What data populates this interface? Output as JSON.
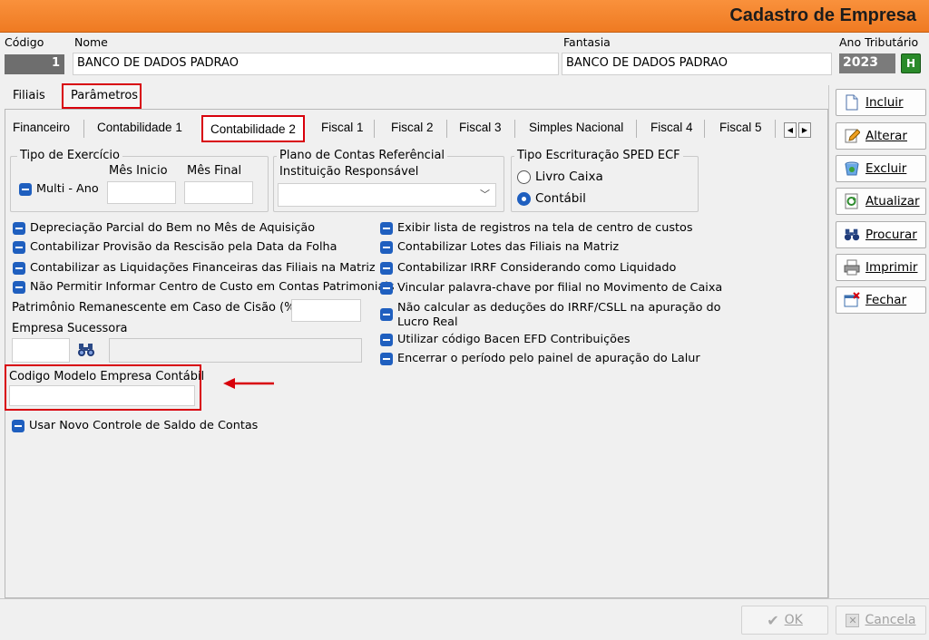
{
  "window": {
    "title": "Cadastro de Empresa"
  },
  "header": {
    "codigo_label": "Código",
    "codigo_value": "1",
    "nome_label": "Nome",
    "nome_value": "BANCO DE DADOS PADRAO",
    "fantasia_label": "Fantasia",
    "fantasia_value": "BANCO DE DADOS PADRAO",
    "ano_label": "Ano Tributário",
    "ano_value": "2023",
    "help_label": "H"
  },
  "main_tabs": [
    {
      "label": "Filiais"
    },
    {
      "label": "Parâmetros",
      "active": true
    }
  ],
  "sub_tabs": [
    {
      "label": "Financeiro"
    },
    {
      "label": "Contabilidade 1"
    },
    {
      "label": "Contabilidade 2",
      "active": true
    },
    {
      "label": "Fiscal 1"
    },
    {
      "label": "Fiscal 2"
    },
    {
      "label": "Fiscal 3"
    },
    {
      "label": "Simples Nacional"
    },
    {
      "label": "Fiscal 4"
    },
    {
      "label": "Fiscal 5"
    }
  ],
  "tipo_exercicio": {
    "title": "Tipo de Exercício",
    "multi_ano": "Multi - Ano",
    "mes_inicio": "Mês Inicio",
    "mes_final": "Mês Final"
  },
  "plano_contas": {
    "title": "Plano de Contas Referêncial",
    "instituicao": "Instituição Responsável"
  },
  "sped": {
    "title": "Tipo Escrituração SPED ECF",
    "options": [
      {
        "label": "Livro Caixa",
        "selected": false
      },
      {
        "label": "Contábil",
        "selected": true
      }
    ]
  },
  "checks_left": [
    "Depreciação Parcial do Bem no Mês de Aquisição",
    "Contabilizar Provisão da Rescisão pela Data da Folha",
    "Contabilizar as Liquidações Financeiras das Filiais na Matriz",
    "Não Permitir Informar Centro de Custo em Contas Patrimoniais"
  ],
  "checks_right": [
    "Exibir lista de registros na tela de centro de custos",
    "Contabilizar Lotes das Filiais na Matriz",
    "Contabilizar IRRF Considerando como Liquidado",
    "Vincular palavra-chave por filial no Movimento de Caixa",
    "Não calcular as deduções do IRRF/CSLL na apuração do Lucro Real",
    "Utilizar código Bacen EFD Contribuições",
    "Encerrar o período pelo painel de apuração do Lalur"
  ],
  "patrimonio_label": "Patrimônio Remanescente em Caso de Cisão (%):",
  "empresa_sucessora_label": "Empresa Sucessora",
  "codigo_modelo_label": "Codigo Modelo Empresa Contábil",
  "usar_novo_label": "Usar Novo Controle de Saldo de Contas",
  "side_buttons": [
    {
      "label": "Incluir",
      "icon": "new-document-icon"
    },
    {
      "label": "Alterar",
      "icon": "edit-pencil-icon"
    },
    {
      "label": "Excluir",
      "icon": "recycle-bin-icon"
    },
    {
      "label": "Atualizar",
      "icon": "refresh-icon"
    },
    {
      "label": "Procurar",
      "icon": "binoculars-icon"
    },
    {
      "label": "Imprimir",
      "icon": "printer-icon"
    },
    {
      "label": "Fechar",
      "icon": "close-window-icon"
    }
  ],
  "footer": {
    "ok": "OK",
    "cancel": "Cancela"
  },
  "colors": {
    "accent": "#ef7a22",
    "highlight": "#d8000b",
    "checkbox": "#1f5fbf"
  }
}
